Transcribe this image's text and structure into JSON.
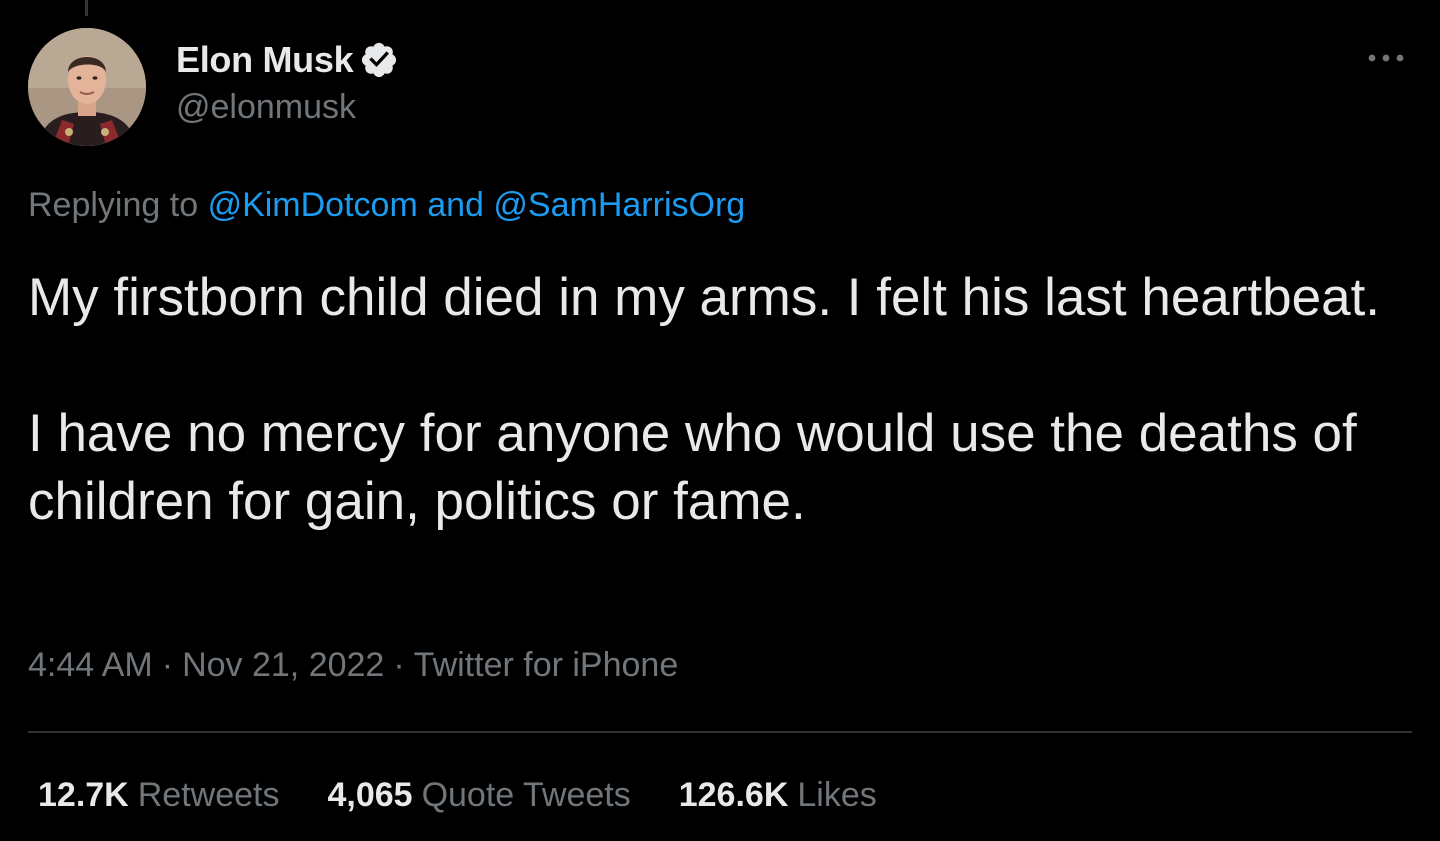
{
  "author": {
    "display_name": "Elon Musk",
    "handle": "@elonmusk",
    "verified_icon": "verified-badge-icon",
    "avatar": "profile-photo"
  },
  "reply": {
    "prefix": "Replying to",
    "mention_1": "@KimDotcom",
    "conjunction": "and",
    "mention_2": "@SamHarrisOrg"
  },
  "tweet": {
    "paragraph_1": "My firstborn child died in my arms. I felt his last heartbeat.",
    "paragraph_2": "I have no mercy for anyone who would use the deaths of children for gain, politics or fame."
  },
  "meta": {
    "time": "4:44 AM",
    "separator": "·",
    "date": "Nov 21, 2022",
    "source": "Twitter for iPhone"
  },
  "stats": {
    "retweets_count": "12.7K",
    "retweets_label": "Retweets",
    "quotes_count": "4,065",
    "quotes_label": "Quote Tweets",
    "likes_count": "126.6K",
    "likes_label": "Likes"
  },
  "colors": {
    "background": "#000000",
    "primary_text": "#e7e9ea",
    "secondary_text": "#71767b",
    "link": "#1d9bf0",
    "divider": "#2f3336"
  },
  "icons": {
    "more": "more-horizontal-icon"
  }
}
